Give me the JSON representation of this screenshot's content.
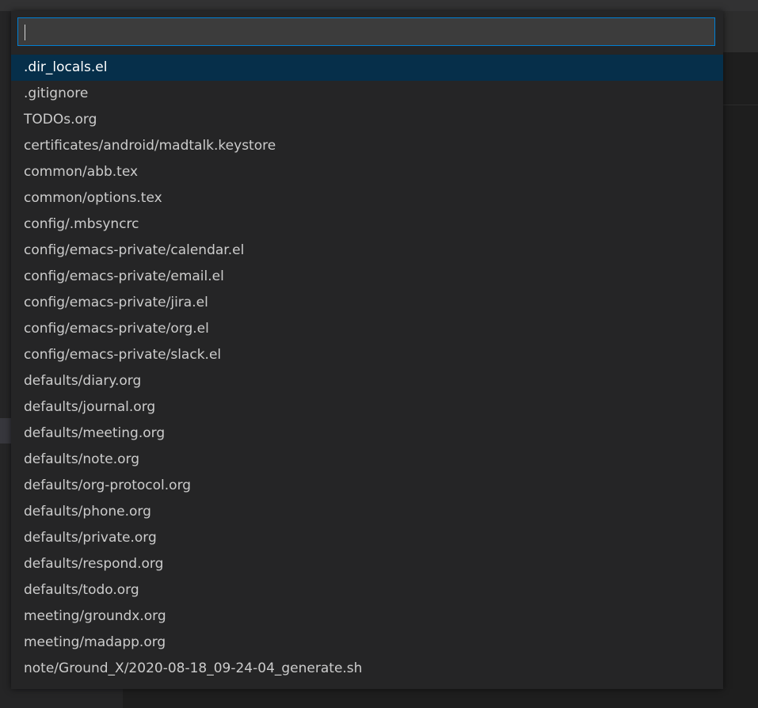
{
  "colors": {
    "background": "#1e1e1e",
    "panel": "#252526",
    "input_bg": "#3c3c3c",
    "focus_border": "#007fd4",
    "selected_bg": "#062f4a",
    "text": "#cccccc"
  },
  "quick_open": {
    "search": {
      "value": "",
      "placeholder": ""
    },
    "selected_index": 0,
    "items": [
      {
        "label": ".dir_locals.el"
      },
      {
        "label": ".gitignore"
      },
      {
        "label": "TODOs.org"
      },
      {
        "label": "certificates/android/madtalk.keystore"
      },
      {
        "label": "common/abb.tex"
      },
      {
        "label": "common/options.tex"
      },
      {
        "label": "config/.mbsyncrc"
      },
      {
        "label": "config/emacs-private/calendar.el"
      },
      {
        "label": "config/emacs-private/email.el"
      },
      {
        "label": "config/emacs-private/jira.el"
      },
      {
        "label": "config/emacs-private/org.el"
      },
      {
        "label": "config/emacs-private/slack.el"
      },
      {
        "label": "defaults/diary.org"
      },
      {
        "label": "defaults/journal.org"
      },
      {
        "label": "defaults/meeting.org"
      },
      {
        "label": "defaults/note.org"
      },
      {
        "label": "defaults/org-protocol.org"
      },
      {
        "label": "defaults/phone.org"
      },
      {
        "label": "defaults/private.org"
      },
      {
        "label": "defaults/respond.org"
      },
      {
        "label": "defaults/todo.org"
      },
      {
        "label": "meeting/groundx.org"
      },
      {
        "label": "meeting/madapp.org"
      },
      {
        "label": "note/Ground_X/2020-08-18_09-24-04_generate.sh"
      }
    ]
  }
}
